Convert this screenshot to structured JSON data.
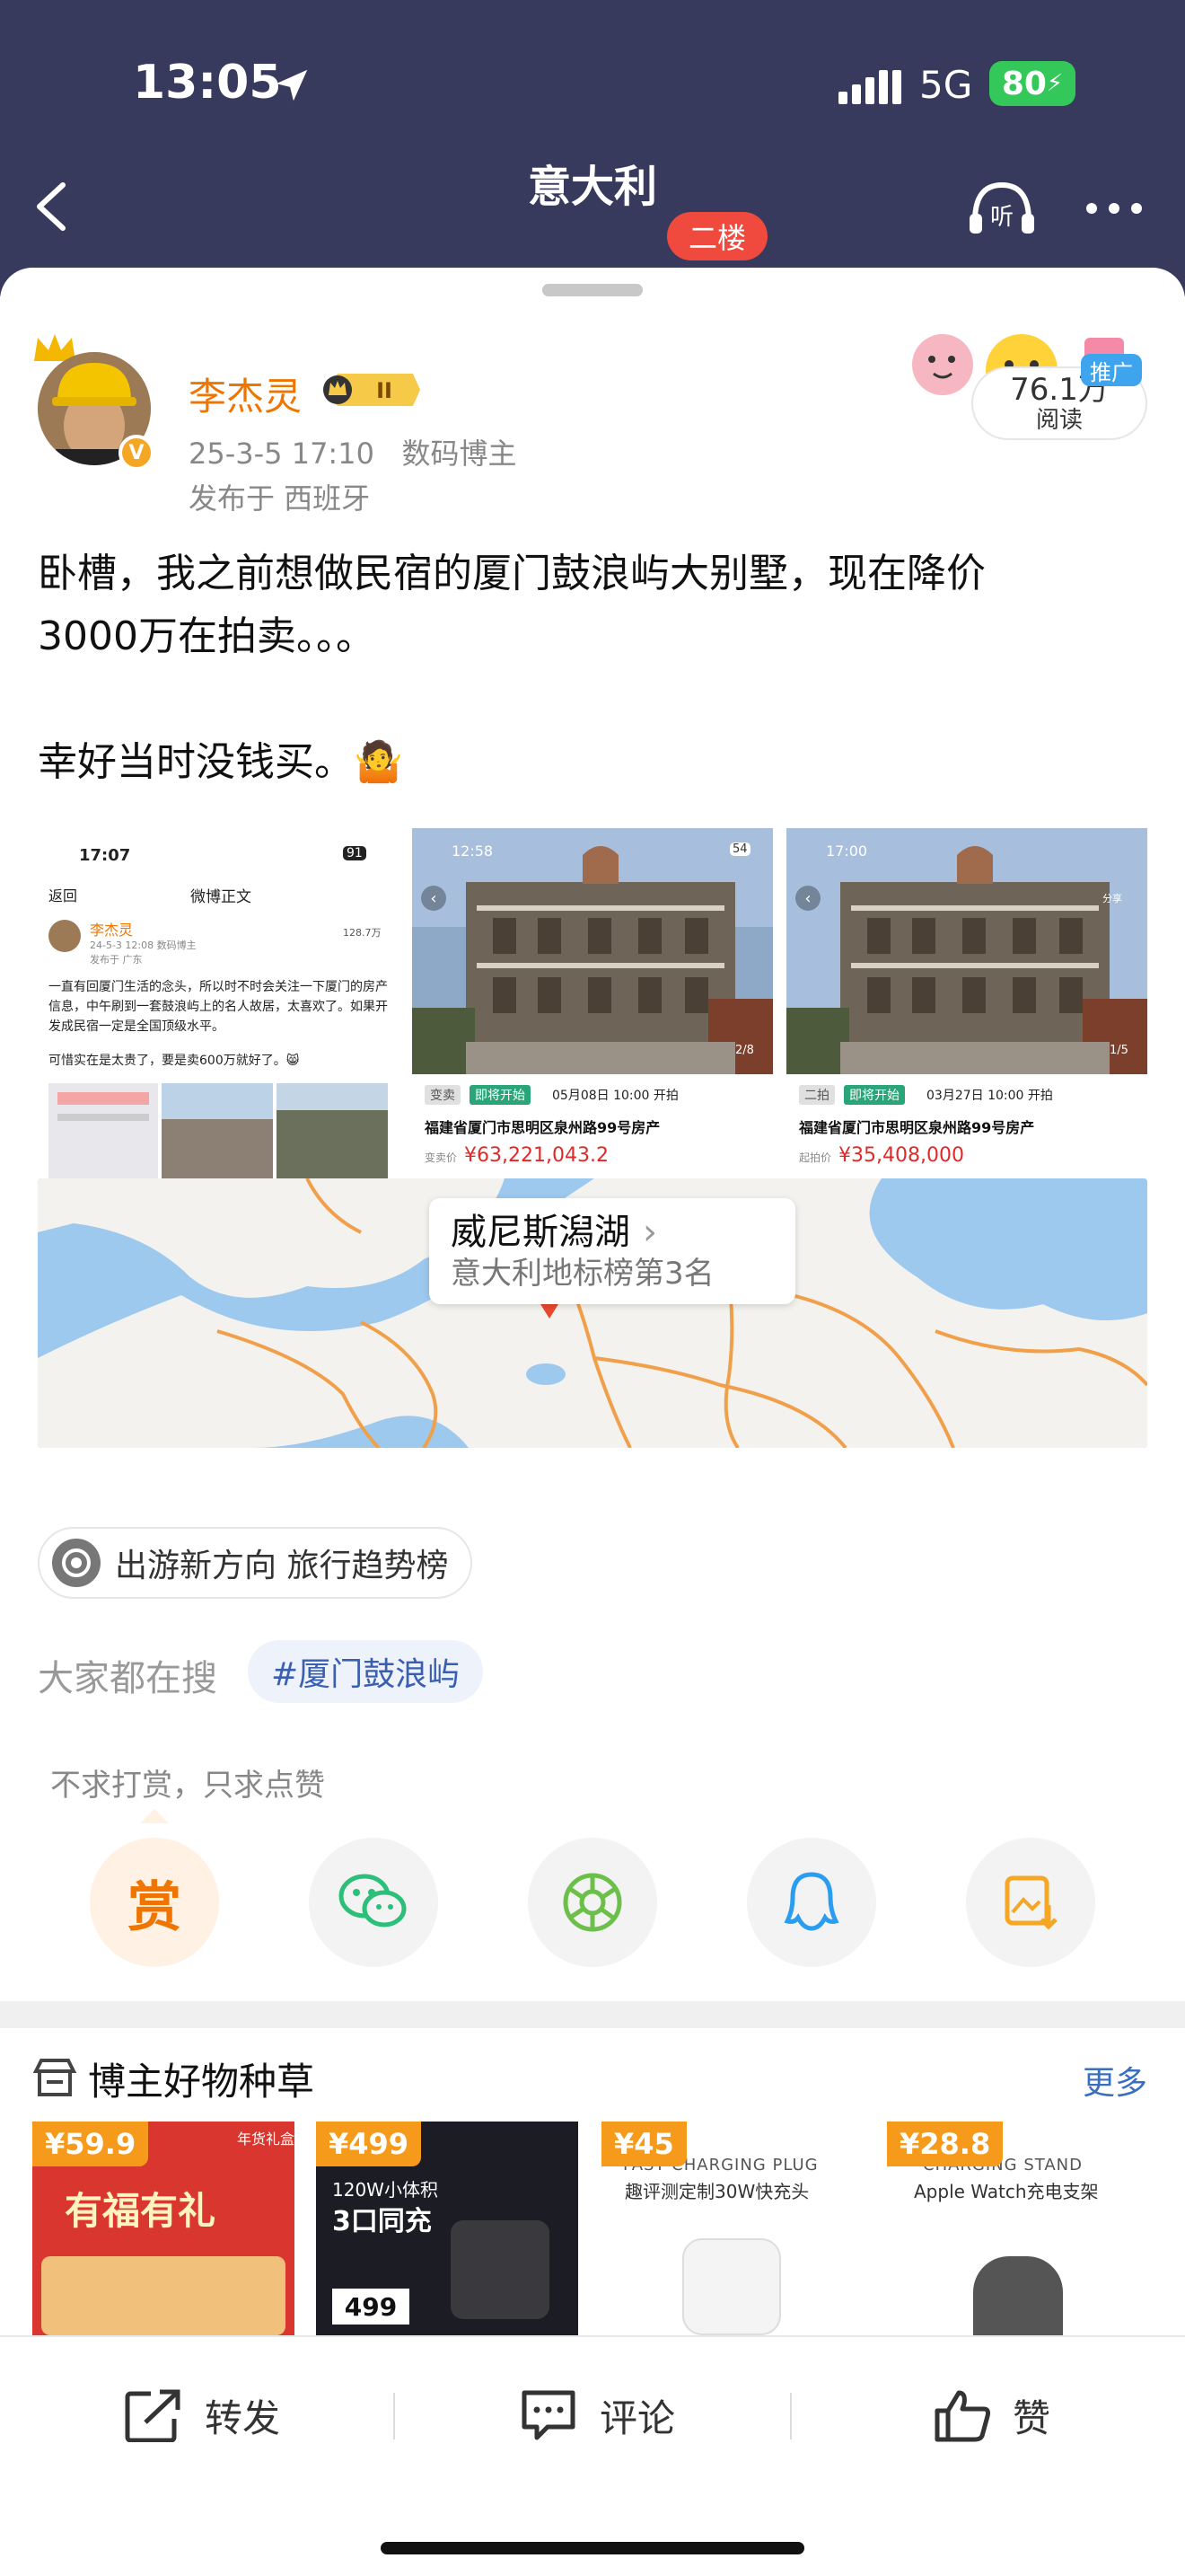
{
  "status_bar": {
    "time": "13:05",
    "network": "5G",
    "battery": "80"
  },
  "nav": {
    "title": "意大利",
    "floor_badge": "二楼"
  },
  "post": {
    "author": "李杰灵",
    "level_badge": "II",
    "verified_mark": "V",
    "timestamp": "25-3-5 17:10",
    "author_type": "数码博主",
    "location": "发布于 西班牙",
    "reads_count": "76.1万",
    "reads_label": "阅读",
    "promo_label": "推广",
    "text_line1": "卧槽，我之前想做民宿的厦门鼓浪屿大别墅，现在降价",
    "text_line2": "3000万在拍卖。。。",
    "text_line3": "幸好当时没钱买。🤷"
  },
  "thumbnails": [
    {
      "time": "17:07",
      "battery": "91",
      "back": "返回",
      "header": "微博正文",
      "author": "李杰灵",
      "meta": "24-5-3 12:08 数码博主",
      "location": "发布于 广东",
      "reads": "128.7万",
      "body": "一直有回厦门生活的念头，所以时不时会关注一下厦门的房产信息，中午刷到一套鼓浪屿上的名人故居，太喜欢了。如果开发成民宿一定是全国顶级水平。",
      "body2": "可惜实在是太贵了，要是卖600万就好了。😸"
    },
    {
      "time": "12:58",
      "battery": "54",
      "pager": "2/8",
      "tag1": "变卖",
      "tag2": "即将开始",
      "date": "05月08日 10:00 开拍",
      "address": "福建省厦门市思明区泉州路99号房产",
      "price_label": "变卖价",
      "price": "¥63,221,043.2"
    },
    {
      "time": "17:00",
      "pager": "1/5",
      "share": "分享",
      "tag1": "二拍",
      "tag2": "即将开始",
      "date": "03月27日 10:00 开拍",
      "address": "福建省厦门市思明区泉州路99号房产",
      "price_label": "起拍价",
      "price": "¥35,408,000"
    }
  ],
  "map": {
    "place": "威尼斯潟湖",
    "rank": "意大利地标榜第3名"
  },
  "trend": {
    "label": "出游新方向 旅行趋势榜"
  },
  "search": {
    "label": "大家都在搜",
    "tag": "#厦门鼓浪屿"
  },
  "reward": {
    "tip": "不求打赏，只求点赞",
    "label": "赏"
  },
  "shop": {
    "title": "博主好物种草",
    "more": "更多",
    "products": [
      {
        "price": "¥59.9",
        "line1": "年货礼盒",
        "line2": "有福有礼"
      },
      {
        "price": "¥499",
        "line1": "120W小体积",
        "line2": "3口同充",
        "line3": "499"
      },
      {
        "price": "¥45",
        "line1": "FAST CHARGING PLUG",
        "line2": "趣评测定制30W快充头"
      },
      {
        "price": "¥28.8",
        "line1": "CHARGING STAND",
        "line2": "Apple Watch充电支架"
      }
    ]
  },
  "actions": {
    "repost": "转发",
    "comment": "评论",
    "like": "赞"
  }
}
